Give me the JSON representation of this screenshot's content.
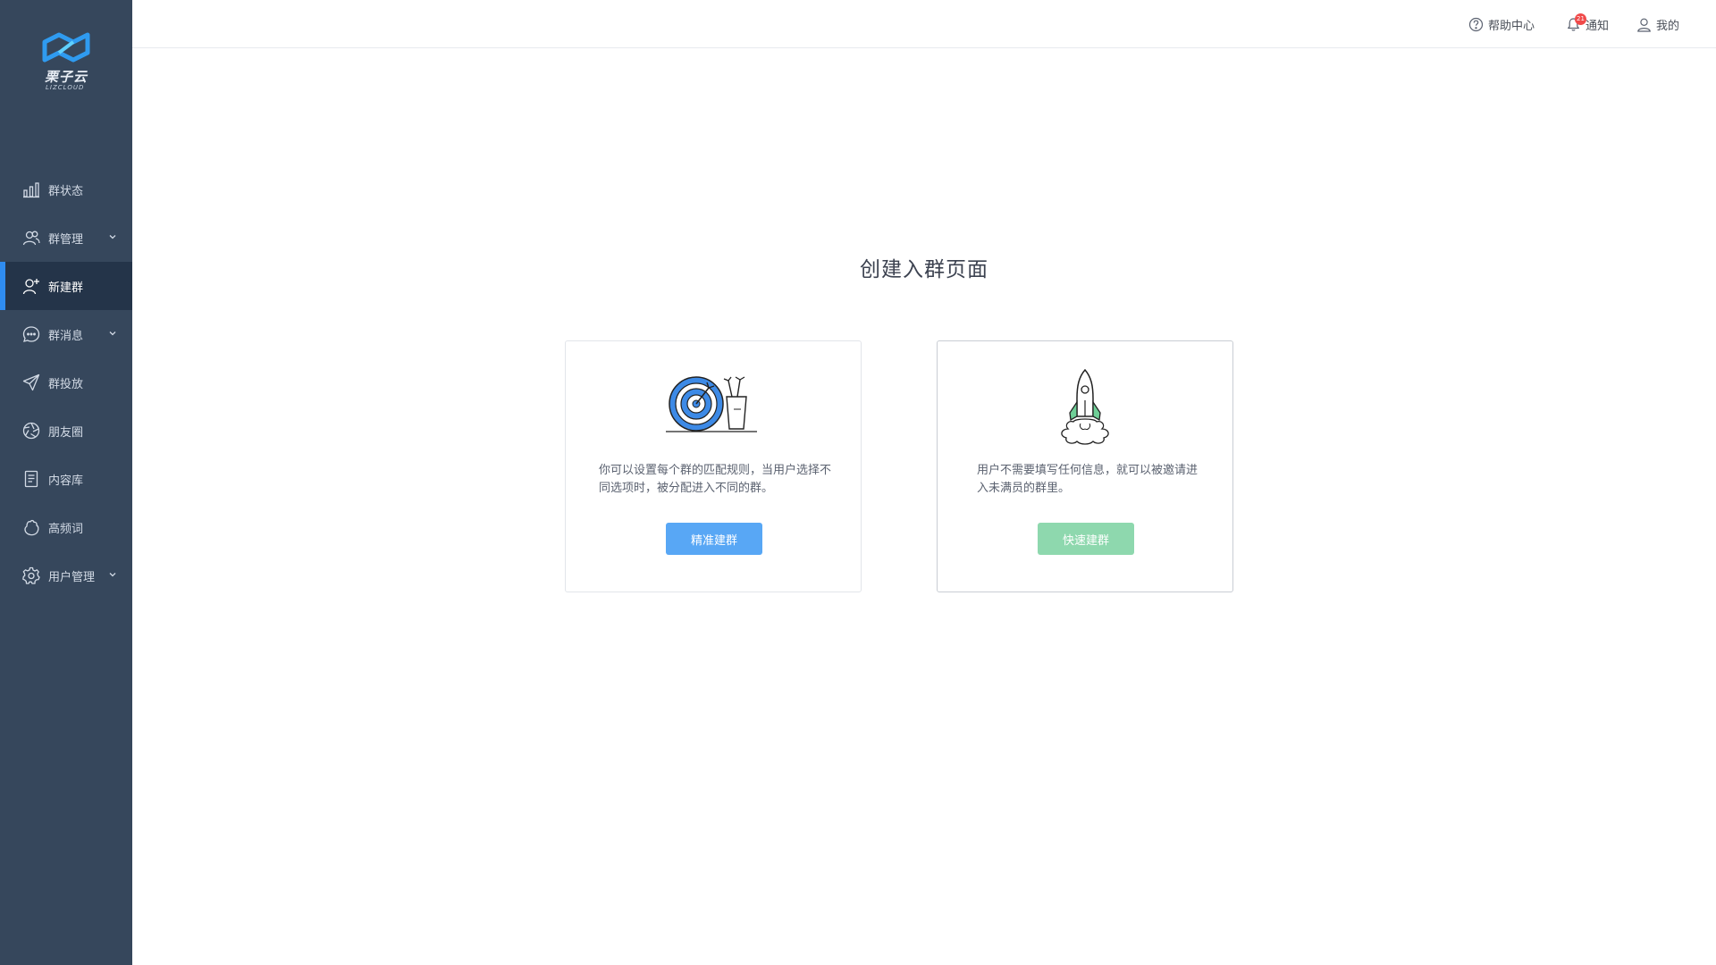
{
  "brand": {
    "name": "栗子云",
    "sub": "LIZCLOUD"
  },
  "sidebar": {
    "items": [
      {
        "label": "群状态",
        "icon": "bar-chart-icon",
        "chevron": false,
        "active": false
      },
      {
        "label": "群管理",
        "icon": "users-icon",
        "chevron": true,
        "active": false
      },
      {
        "label": "新建群",
        "icon": "add-user-icon",
        "chevron": false,
        "active": true
      },
      {
        "label": "群消息",
        "icon": "chat-bubble-icon",
        "chevron": true,
        "active": false
      },
      {
        "label": "群投放",
        "icon": "paper-plane-icon",
        "chevron": false,
        "active": false
      },
      {
        "label": "朋友圈",
        "icon": "aperture-icon",
        "chevron": false,
        "active": false
      },
      {
        "label": "内容库",
        "icon": "document-icon",
        "chevron": false,
        "active": false
      },
      {
        "label": "高频词",
        "icon": "hand-icon",
        "chevron": false,
        "active": false
      },
      {
        "label": "用户管理",
        "icon": "gear-icon",
        "chevron": true,
        "active": false
      }
    ]
  },
  "header": {
    "help": "帮助中心",
    "notify": "通知",
    "notify_badge": "21",
    "mine": "我的"
  },
  "main": {
    "title": "创建入群页面",
    "cards": [
      {
        "icon": "target-icon",
        "desc": "你可以设置每个群的匹配规则，当用户选择不同选项时，被分配进入不同的群。",
        "button": "精准建群"
      },
      {
        "icon": "rocket-icon",
        "desc": "用户不需要填写任何信息，就可以被邀请进入未满员的群里。",
        "button": "快速建群"
      }
    ]
  },
  "colors": {
    "sidebar": "#36475c",
    "active": "#243449",
    "accent": "#2f8cf0",
    "blue_button": "#58a7f5",
    "green_button": "#8ed8ae"
  }
}
